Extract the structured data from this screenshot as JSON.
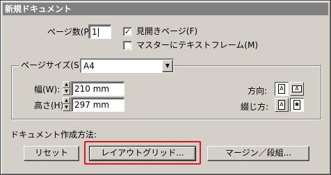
{
  "window": {
    "title": "新規ドキュメント"
  },
  "pages": {
    "label": "ページ数(P):",
    "value": "1",
    "facing_label": "見開きページ(F)",
    "facing_checked": true,
    "master_label": "マスターにテキストフレーム(M)",
    "master_checked": false
  },
  "page_size": {
    "label": "ページサイズ(S):",
    "value": "A4",
    "width_label": "幅(W):",
    "width_value": "210 mm",
    "height_label": "高さ(H):",
    "height_value": "297 mm",
    "orientation_label": "方向:",
    "binding_label": "綴じ方:"
  },
  "create": {
    "label": "ドキュメント作成方法:",
    "reset_label": "リセット",
    "layout_grid_label": "レイアウトグリッド...",
    "margin_label": "マージン／段組..."
  },
  "colors": {
    "highlight": "#e8141b"
  }
}
